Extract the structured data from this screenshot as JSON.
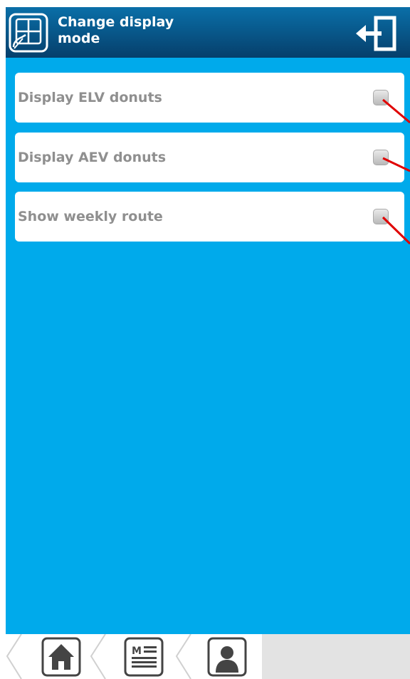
{
  "header": {
    "title_line1": "Change display",
    "title_line2": "mode",
    "app_icon": "display-mode-icon",
    "exit_icon": "exit-icon"
  },
  "options": [
    {
      "label": "Display ELV donuts",
      "checked": false
    },
    {
      "label": "Display AEV donuts",
      "checked": false
    },
    {
      "label": "Show weekly route",
      "checked": false
    }
  ],
  "bottom_nav": {
    "items": [
      {
        "icon": "home-icon"
      },
      {
        "icon": "menu-icon",
        "text": "M"
      },
      {
        "icon": "person-icon"
      }
    ]
  },
  "colors": {
    "background": "#00aaeb",
    "header": "#0a5a8f",
    "label": "#8f8f8f",
    "annotation": "#e00000"
  }
}
